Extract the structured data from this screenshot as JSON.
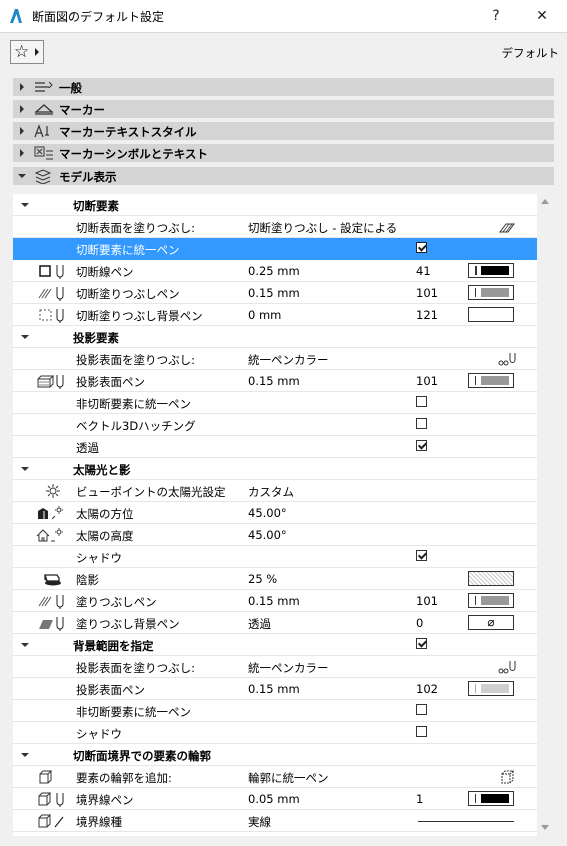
{
  "window": {
    "title": "断面図のデフォルト設定",
    "help_label": "?",
    "close_label": "✕"
  },
  "toolbar": {
    "favorites_icon": "star-icon",
    "default_label": "デフォルト"
  },
  "sections": [
    {
      "label": "一般",
      "icon": "general-settings-icon",
      "expanded": false
    },
    {
      "label": "マーカー",
      "icon": "marker-icon",
      "expanded": false
    },
    {
      "label": "マーカーテキストスタイル",
      "icon": "text-style-icon",
      "expanded": false
    },
    {
      "label": "マーカーシンボルとテキスト",
      "icon": "symbol-text-icon",
      "expanded": false
    },
    {
      "label": "モデル表示",
      "icon": "model-display-icon",
      "expanded": true
    }
  ],
  "groups": {
    "cut": "切断要素",
    "projected": "投影要素",
    "sun": "太陽光と影",
    "bounded": "背景範囲を指定",
    "contours": "切断面境界での要素の輪郭"
  },
  "rows": {
    "cut_fill": {
      "label": "切断表面を塗りつぶし:",
      "value": "切断塗りつぶし - 設定による"
    },
    "cut_uniform": {
      "label": "切断要素に統一ペン",
      "checked": true,
      "selected": true
    },
    "cut_line_pen": {
      "label": "切断線ペン",
      "value": "0.25 mm",
      "num": "41",
      "pen_color": "#000000"
    },
    "cut_fill_pen": {
      "label": "切断塗りつぶしペン",
      "value": "0.15 mm",
      "num": "101",
      "pen_color": "#999999"
    },
    "cut_fill_bg_pen": {
      "label": "切断塗りつぶし背景ペン",
      "value": "0 mm",
      "num": "121"
    },
    "proj_fill": {
      "label": "投影表面を塗りつぶし:",
      "value": "統一ペンカラー"
    },
    "proj_surface_pen": {
      "label": "投影表面ペン",
      "value": "0.15 mm",
      "num": "101",
      "pen_color": "#999999"
    },
    "proj_uncut_uniform": {
      "label": "非切断要素に統一ペン",
      "checked": false
    },
    "vector_hatch": {
      "label": "ベクトル3Dハッチング",
      "checked": false
    },
    "transparency": {
      "label": "透過",
      "checked": true
    },
    "viewpoint_sun": {
      "label": "ビューポイントの太陽光設定",
      "value": "カスタム"
    },
    "sun_azimuth": {
      "label": "太陽の方位",
      "value": "45.00°"
    },
    "sun_altitude": {
      "label": "太陽の高度",
      "value": "45.00°"
    },
    "shadows": {
      "label": "シャドウ",
      "checked": true
    },
    "shading": {
      "label": "陰影",
      "value": "25 %"
    },
    "fill_pen": {
      "label": "塗りつぶしペン",
      "value": "0.15 mm",
      "num": "101",
      "pen_color": "#999999"
    },
    "fill_bg_pen": {
      "label": "塗りつぶし背景ペン",
      "value": "透過",
      "num": "0",
      "glyph": "⌀"
    },
    "bounded_fill": {
      "label": "投影表面を塗りつぶし:",
      "value": "統一ペンカラー"
    },
    "bounded_surface_pen": {
      "label": "投影表面ペン",
      "value": "0.15 mm",
      "num": "102",
      "pen_color": "#cfcfcf"
    },
    "bounded_uncut_uniform": {
      "label": "非切断要素に統一ペン",
      "checked": false
    },
    "bounded_shadows": {
      "label": "シャドウ",
      "checked": false
    },
    "add_contours": {
      "label": "要素の輪郭を追加:",
      "value": "輪郭に統一ペン"
    },
    "boundary_pen": {
      "label": "境界線ペン",
      "value": "0.05 mm",
      "num": "1",
      "pen_color": "#000000"
    },
    "boundary_linetype": {
      "label": "境界線種",
      "value": "実線"
    }
  },
  "bounded_checked": true,
  "colors": {
    "selection": "#3399ff",
    "section_bg": "#d4d4d4",
    "panel_bg": "#ffffff",
    "accent": "#1e88c8"
  }
}
